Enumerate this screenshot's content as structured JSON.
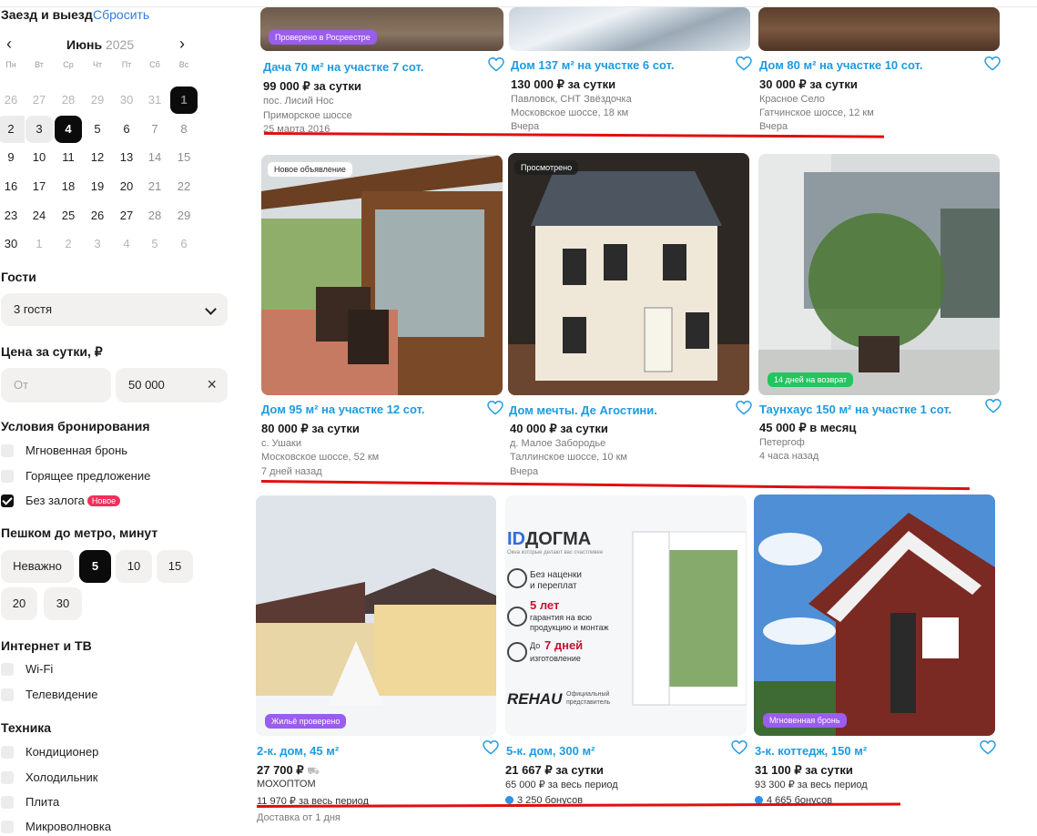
{
  "sidebar": {
    "dates": {
      "title": "Заезд и выезд",
      "reset": "Сбросить"
    },
    "calendar": {
      "month": "Июнь",
      "year": "2025",
      "weekdays": [
        "Пн",
        "Вт",
        "Ср",
        "Чт",
        "Пт",
        "Сб",
        "Вс"
      ],
      "rows": [
        [
          "26",
          "27",
          "28",
          "29",
          "30",
          "31",
          "1"
        ],
        [
          "2",
          "3",
          "4",
          "5",
          "6",
          "7",
          "8"
        ],
        [
          "9",
          "10",
          "11",
          "12",
          "13",
          "14",
          "15"
        ],
        [
          "16",
          "17",
          "18",
          "19",
          "20",
          "21",
          "22"
        ],
        [
          "23",
          "24",
          "25",
          "26",
          "27",
          "28",
          "29"
        ],
        [
          "30",
          "1",
          "2",
          "3",
          "4",
          "5",
          "6"
        ]
      ]
    },
    "guests": {
      "title": "Гости",
      "value": "3 гостя"
    },
    "price": {
      "title": "Цена за сутки, ₽",
      "from_placeholder": "От",
      "to_value": "50 000"
    },
    "booking": {
      "title": "Условия бронирования",
      "items": [
        {
          "label": "Мгновенная бронь",
          "checked": false
        },
        {
          "label": "Горящее предложение",
          "checked": false
        },
        {
          "label": "Без залога",
          "checked": true,
          "badge": "Новое"
        }
      ]
    },
    "metro": {
      "title": "Пешком до метро, минут",
      "options": [
        "Неважно",
        "5",
        "10",
        "15",
        "20",
        "30"
      ],
      "selected": "5"
    },
    "internet": {
      "title": "Интернет и ТВ",
      "items": [
        "Wi-Fi",
        "Телевидение"
      ]
    },
    "appliances": {
      "title": "Техника",
      "items": [
        "Кондиционер",
        "Холодильник",
        "Плита",
        "Микроволновка"
      ]
    }
  },
  "listings": [
    {
      "title": "Дача 70 м² на участке 7 сот.",
      "price": "99 000 ₽ за сутки",
      "lines": [
        "пос. Лисий Нос",
        "Приморское шоссе",
        "25 марта 2016"
      ],
      "tag": "Проверено в Росреестре"
    },
    {
      "title": "Дом 137 м² на участке 6 сот.",
      "price": "130 000 ₽ за сутки",
      "lines": [
        "Павловск, СНТ Звёздочка",
        "Московское шоссе, 18 км",
        "Вчера"
      ]
    },
    {
      "title": "Дом 80 м² на участке 10 сот.",
      "price": "30 000 ₽ за сутки",
      "lines": [
        "Красное Село",
        "Гатчинское шоссе, 12 км",
        "Вчера"
      ]
    },
    {
      "title": "Дом 95 м² на участке 12 сот.",
      "price": "80 000 ₽ за сутки",
      "lines": [
        "с. Ушаки",
        "Московское шоссе, 52 км",
        "7 дней назад"
      ],
      "tag": "Новое объявление"
    },
    {
      "title": "Дом мечты. Де Агостини.",
      "price": "40 000 ₽ за сутки",
      "lines": [
        "д. Малое Забородье",
        "Таллинское шоссе, 10 км",
        "Вчера"
      ],
      "tag": "Просмотрено"
    },
    {
      "title": "Таунхаус 150 м² на участке 1 сот.",
      "price": "45 000 ₽ в месяц",
      "lines": [
        "Петергоф",
        "4 часа назад"
      ],
      "tag": "14 дней на возврат"
    },
    {
      "title": "2-к. дом, 45 м²",
      "price": "27 700 ₽",
      "lines": [
        "МОХОПТОМ",
        "11 970 ₽ за весь период",
        "Доставка от 1 дня"
      ],
      "tag": "Жильё проверено"
    },
    {
      "title": "5-к. дом, 300 м²",
      "price": "21 667 ₽ за сутки",
      "lines": [
        "65 000 ₽ за весь период",
        "3 250 бонусов"
      ]
    },
    {
      "title": "3-к. коттедж, 150 м²",
      "price": "31 100 ₽ за сутки",
      "lines": [
        "93 300 ₽ за весь период",
        "4 665 бонусов"
      ],
      "tag": "Мгновенная бронь"
    }
  ],
  "ad": {
    "brand": "ДОГМА",
    "subtitle": "Окна которые делают вас счастливее",
    "benefits": [
      {
        "big": "",
        "text1": "Без наценки",
        "text2": "и переплат"
      },
      {
        "big": "5 лет",
        "text1": "гарантия на всю",
        "text2": "продукцию и монтаж"
      },
      {
        "big": "7 дней",
        "pre": "До",
        "text1": "изготовление",
        "text2": ""
      }
    ],
    "rehau": "REHAU",
    "rehau_note1": "Официальный",
    "rehau_note2": "представитель"
  }
}
